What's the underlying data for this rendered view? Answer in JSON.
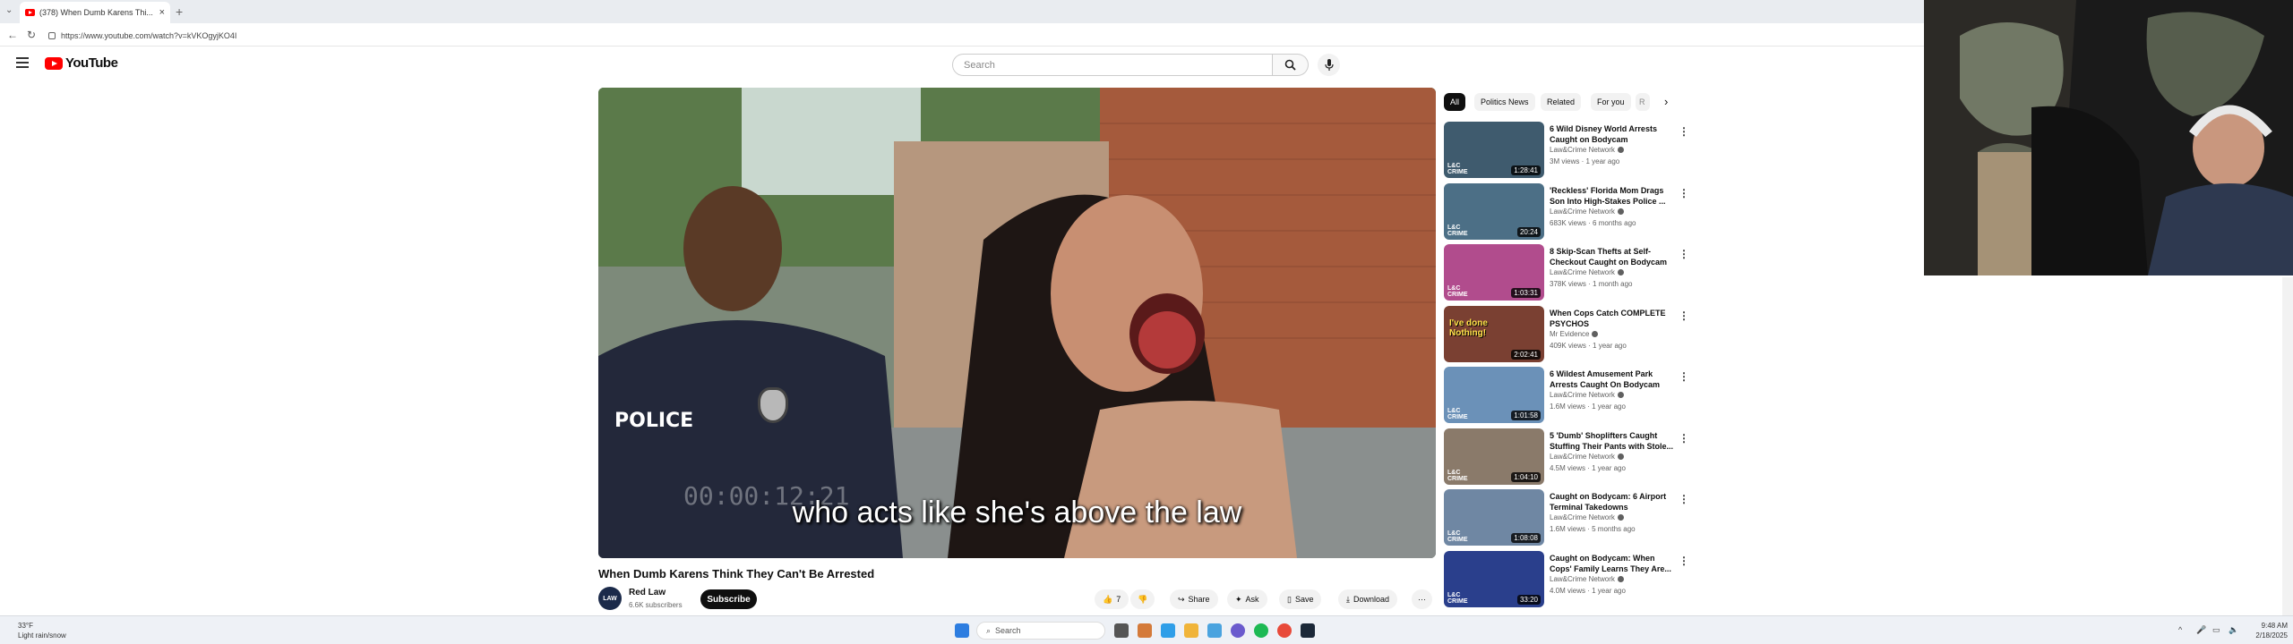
{
  "browser": {
    "tab_title": "(378) When Dumb Karens Thi...",
    "url": "https://www.youtube.com/watch?v=kVKOgyjKO4I"
  },
  "youtube": {
    "logo_text": "YouTube",
    "search_placeholder": "Search"
  },
  "video": {
    "caption": "who acts like she's above the law",
    "overlay_timestamp": "00:00:12:21",
    "vest_text": "POLICE",
    "title": "When Dumb Karens Think They Can't Be Arrested",
    "channel": "Red Law",
    "subscribers": "6.6K subscribers",
    "subscribe_label": "Subscribe",
    "like_count": "7",
    "share_label": "Share",
    "ask_label": "Ask",
    "save_label": "Save",
    "download_label": "Download"
  },
  "chips": [
    "All",
    "Politics News",
    "Related",
    "For you",
    "R"
  ],
  "recommendations": [
    {
      "title": "6 Wild Disney World Arrests Caught on Bodycam",
      "channel": "Law&Crime Network",
      "meta": "3M views · 1 year ago",
      "duration": "1:28:41",
      "thumb": "#3f5b6e"
    },
    {
      "title": "'Reckless' Florida Mom Drags Son Into High-Stakes Police ...",
      "channel": "Law&Crime Network",
      "meta": "683K views · 6 months ago",
      "duration": "20:24",
      "thumb": "#4c6f86"
    },
    {
      "title": "8 Skip-Scan Thefts at Self-Checkout Caught on Bodycam",
      "channel": "Law&Crime Network",
      "meta": "378K views · 1 month ago",
      "duration": "1:03:31",
      "thumb": "#b14c8d"
    },
    {
      "title": "When Cops Catch COMPLETE PSYCHOS",
      "channel": "Mr Evidence",
      "meta": "409K views · 1 year ago",
      "duration": "2:02:41",
      "thumb": "#7a4032",
      "overlay": "I've done Nothing!"
    },
    {
      "title": "6 Wildest Amusement Park Arrests Caught On Bodycam",
      "channel": "Law&Crime Network",
      "meta": "1.6M views · 1 year ago",
      "duration": "1:01:58",
      "thumb": "#6b91b8"
    },
    {
      "title": "5 'Dumb' Shoplifters Caught Stuffing Their Pants with Stole...",
      "channel": "Law&Crime Network",
      "meta": "4.5M views · 1 year ago",
      "duration": "1:04:10",
      "thumb": "#8a7a6a"
    },
    {
      "title": "Caught on Bodycam: 6 Airport Terminal Takedowns",
      "channel": "Law&Crime Network",
      "meta": "1.6M views · 5 months ago",
      "duration": "1:08:08",
      "thumb": "#6f87a3"
    },
    {
      "title": "Caught on Bodycam: When Cops' Family Learns They Are...",
      "channel": "Law&Crime Network",
      "meta": "4.0M views · 1 year ago",
      "duration": "33:20",
      "thumb": "#2a3f8c"
    }
  ],
  "taskbar": {
    "search_label": "Search",
    "weather_temp": "33°F",
    "weather_desc": "Light rain/snow",
    "time": "9:48 AM",
    "date": "2/18/2025"
  },
  "colors": {
    "youtube_red": "#ff0000",
    "chip_active": "#0f0f0f",
    "taskbar_bg": "#eef1f6"
  }
}
